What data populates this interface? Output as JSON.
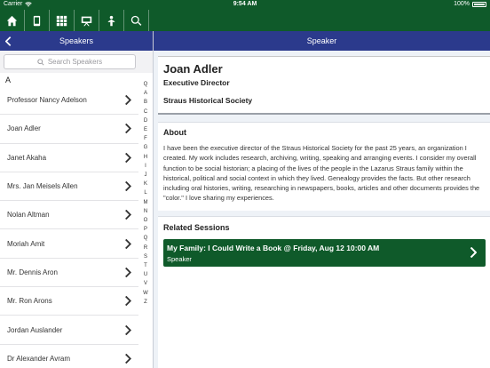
{
  "statusbar": {
    "carrier": "Carrier",
    "time": "9:54 AM",
    "battery": "100%"
  },
  "toolbar": {
    "icons": [
      "home-icon",
      "phone-icon",
      "grid-icon",
      "presentation-icon",
      "person-icon",
      "search-icon"
    ]
  },
  "left_nav": {
    "title": "Speakers"
  },
  "right_nav": {
    "title": "Speaker"
  },
  "search": {
    "placeholder": "Search Speakers"
  },
  "section_header": "A",
  "speakers": [
    "Professor Nancy Adelson",
    "Joan Adler",
    "Janet Akaha",
    "Mrs. Jan Meisels Allen",
    "Nolan Altman",
    "Moriah Amit",
    "Mr. Dennis Aron",
    "Mr. Ron Arons",
    "Jordan Auslander",
    "Dr Alexander Avram"
  ],
  "index_letters": [
    "Q",
    "A",
    "B",
    "C",
    "D",
    "E",
    "F",
    "G",
    "H",
    "I",
    "J",
    "K",
    "L",
    "M",
    "N",
    "O",
    "P",
    "Q",
    "R",
    "S",
    "T",
    "U",
    "V",
    "W",
    "Z"
  ],
  "speaker": {
    "name": "Joan Adler",
    "title": "Executive Director",
    "organization": "Straus Historical Society"
  },
  "about": {
    "heading": "About",
    "text": "I have been the executive director of the Straus Historical Society for the past 25 years, an organization I created. My work includes research, archiving, writing, speaking and arranging events. I consider my overall function to be social historian; a placing of the lives of the people in the Lazarus Straus family within the historical, political and social context in which they lived. Genealogy provides the facts. But other research including oral histories, writing, researching in newspapers, books, articles and other documents provides the \"color.\" I love sharing my experiences."
  },
  "related": {
    "heading": "Related Sessions",
    "sessions": [
      {
        "title": "My Family: I Could Write a Book @ Friday, Aug 12 10:00 AM",
        "subtitle": "Speaker"
      }
    ]
  },
  "colors": {
    "green": "#0f5a2a",
    "blue": "#2b3a8c"
  }
}
